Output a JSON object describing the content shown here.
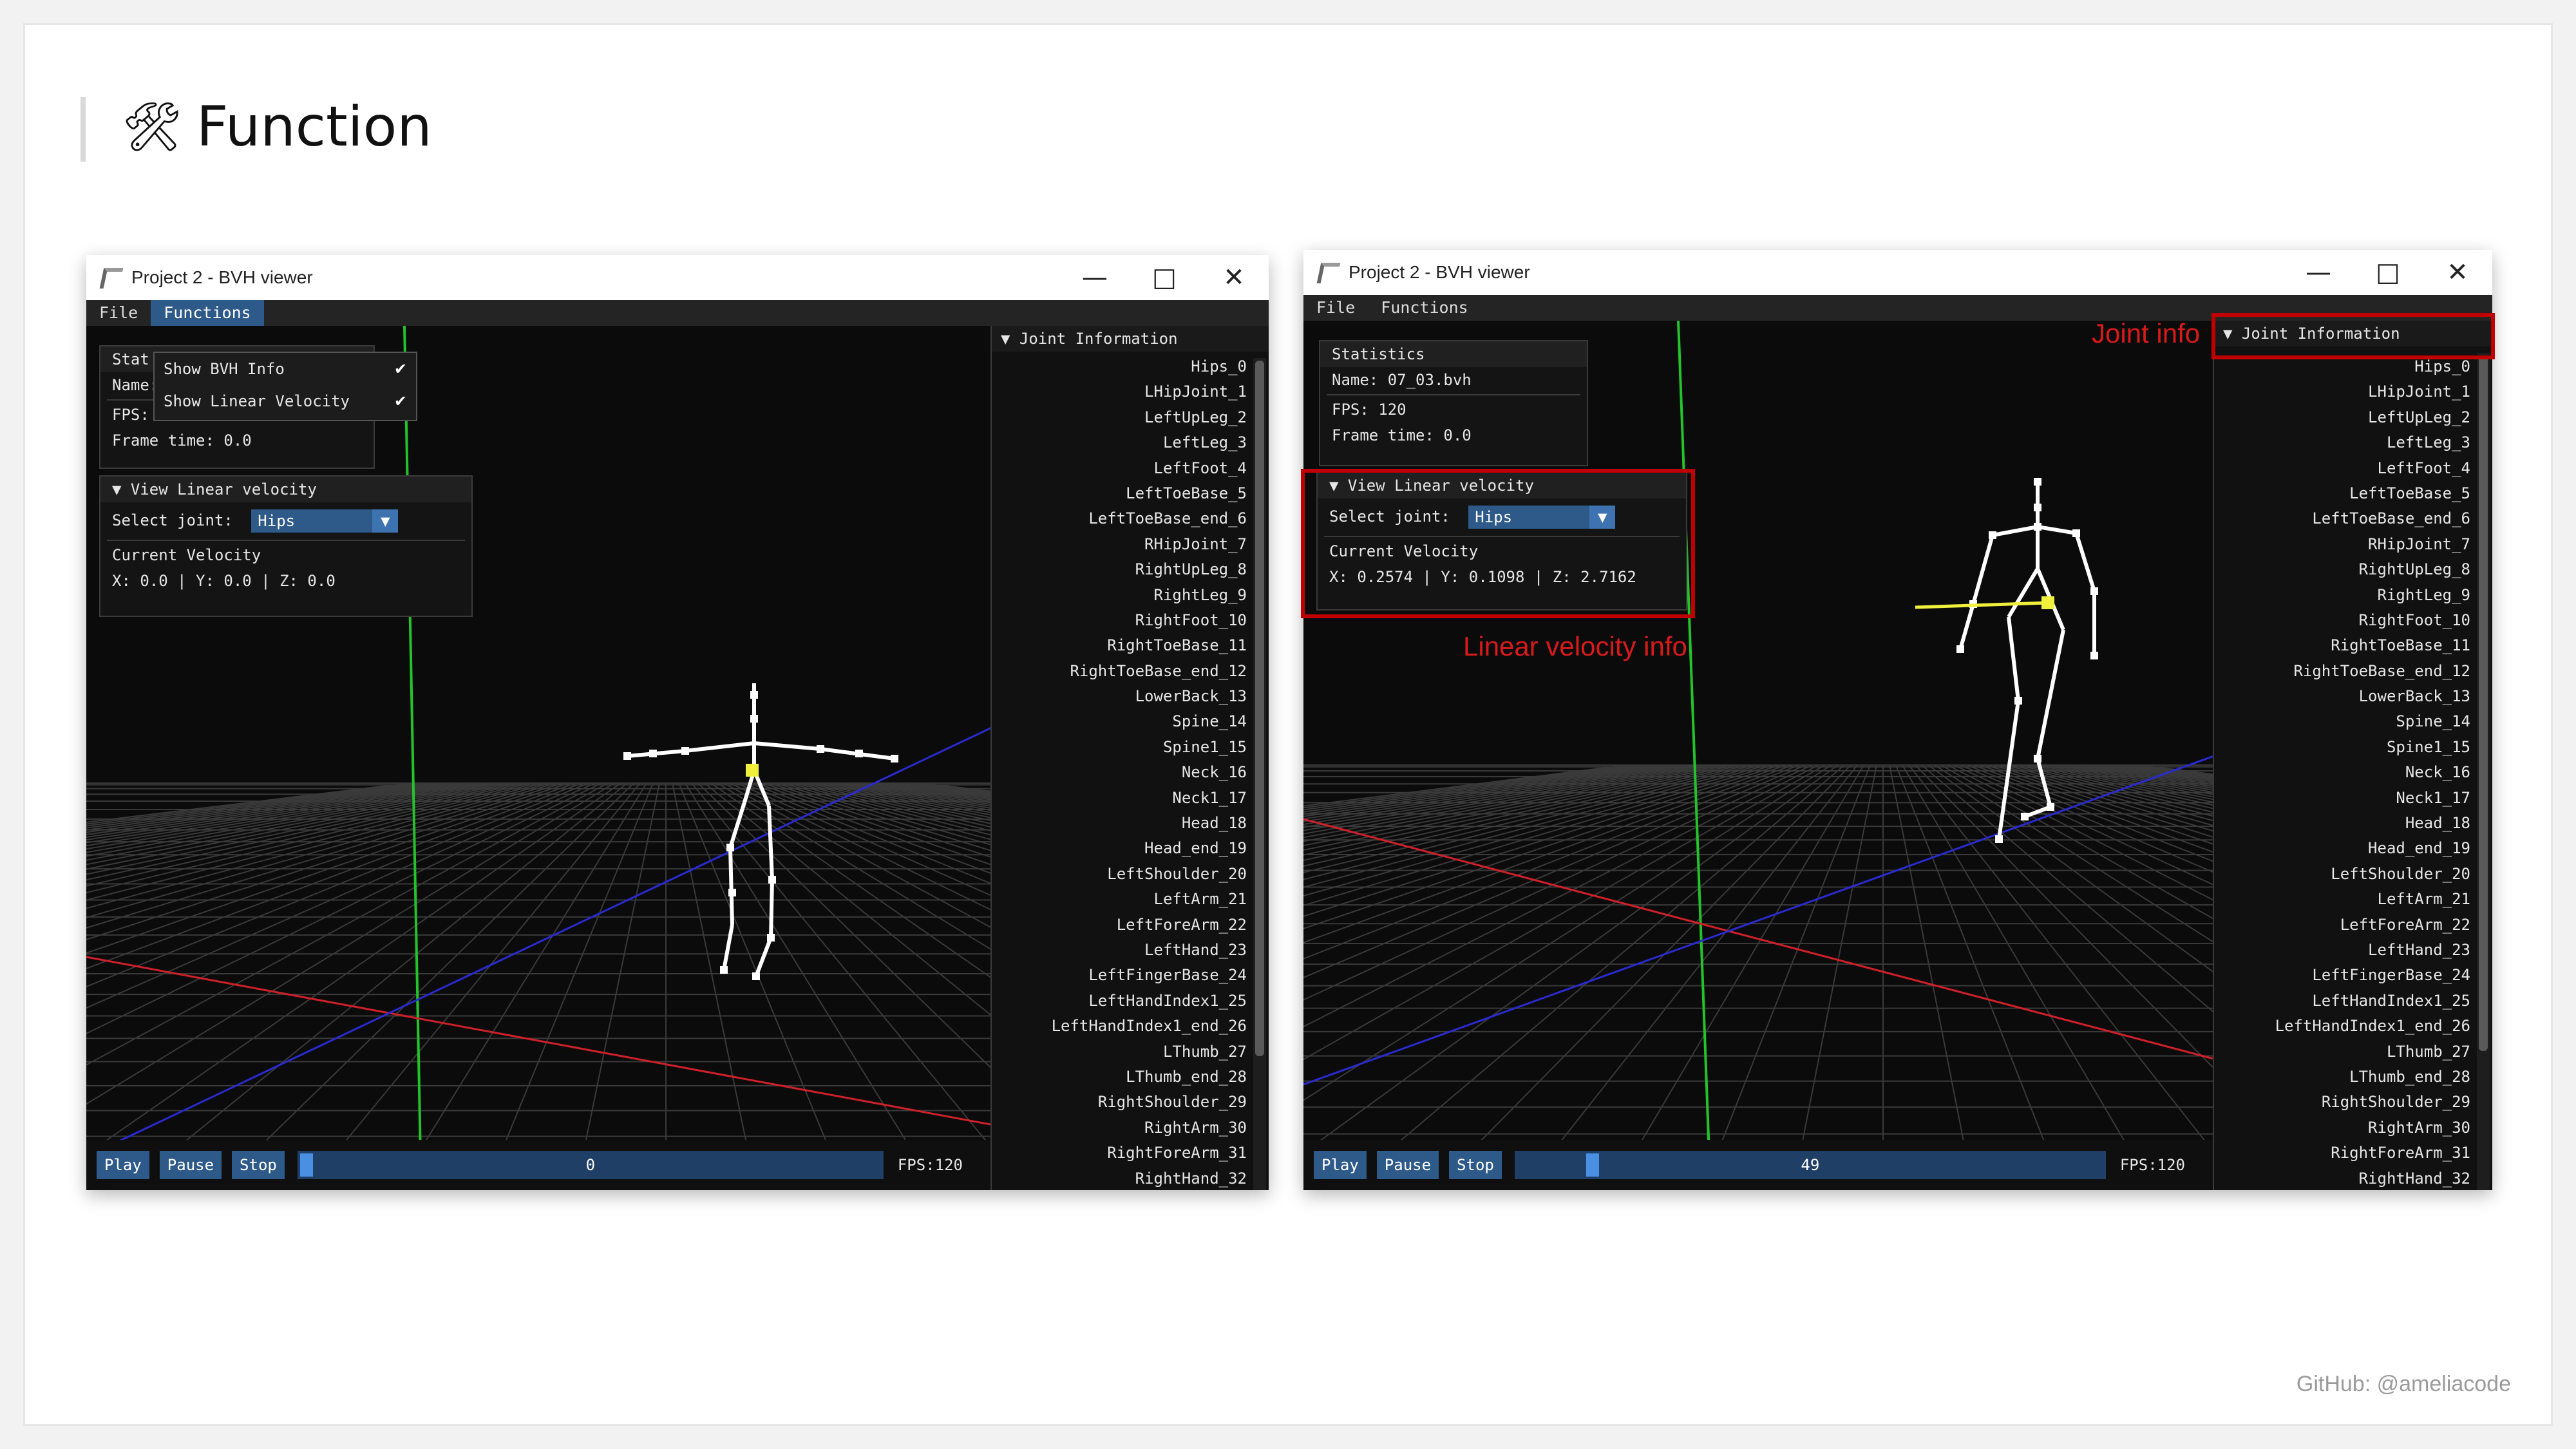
{
  "slide": {
    "title": "Function",
    "title_icon": "hammer-and-wrench-icon",
    "credit": "GitHub: @ameliacode"
  },
  "windows": [
    {
      "title": "Project 2 - BVH viewer",
      "controls": {
        "minimize": "—",
        "maximize": "□",
        "close": "✕"
      },
      "menu": {
        "file": "File",
        "functions": "Functions",
        "active": "Functions"
      },
      "functions_menu": {
        "open": true,
        "items": [
          {
            "label": "Show BVH Info",
            "checked": true
          },
          {
            "label": "Show Linear Velocity",
            "checked": true
          }
        ]
      },
      "stats": {
        "header": "Stat",
        "name": "Name: 07_03.bvh",
        "fps": "FPS: 120",
        "frame_time": "Frame time: 0.0"
      },
      "velocity": {
        "header": "View Linear velocity",
        "select_label": "Select joint:",
        "selected": "Hips",
        "current_label": "Current Velocity",
        "current_value": "X: 0.0 | Y: 0.0 | Z: 0.0"
      },
      "joint_header": "Joint Information",
      "buttons": {
        "play": "Play",
        "pause": "Pause",
        "stop": "Stop"
      },
      "frame": "0",
      "frame_progress": 0.0,
      "fps_label": "FPS:120"
    },
    {
      "title": "Project 2 - BVH viewer",
      "controls": {
        "minimize": "—",
        "maximize": "□",
        "close": "✕"
      },
      "menu": {
        "file": "File",
        "functions": "Functions",
        "active": ""
      },
      "stats": {
        "header": "Statistics",
        "name": "Name: 07_03.bvh",
        "fps": "FPS: 120",
        "frame_time": "Frame time: 0.0"
      },
      "velocity": {
        "header": "View Linear velocity",
        "select_label": "Select joint:",
        "selected": "Hips",
        "current_label": "Current Velocity",
        "current_value": "X: 0.2574 | Y: 0.1098 | Z: 2.7162"
      },
      "joint_header": "Joint Information",
      "buttons": {
        "play": "Play",
        "pause": "Pause",
        "stop": "Stop"
      },
      "frame": "49",
      "frame_progress": 0.12,
      "fps_label": "FPS:120",
      "annotations": {
        "joint_info": "Joint info",
        "velocity_info": "Linear velocity info",
        "color": "#d91a1a"
      }
    }
  ],
  "joints": [
    "Hips_0",
    "LHipJoint_1",
    "LeftUpLeg_2",
    "LeftLeg_3",
    "LeftFoot_4",
    "LeftToeBase_5",
    "LeftToeBase_end_6",
    "RHipJoint_7",
    "RightUpLeg_8",
    "RightLeg_9",
    "RightFoot_10",
    "RightToeBase_11",
    "RightToeBase_end_12",
    "LowerBack_13",
    "Spine_14",
    "Spine1_15",
    "Neck_16",
    "Neck1_17",
    "Head_18",
    "Head_end_19",
    "LeftShoulder_20",
    "LeftArm_21",
    "LeftForeArm_22",
    "LeftHand_23",
    "LeftFingerBase_24",
    "LeftHandIndex1_25",
    "LeftHandIndex1_end_26",
    "LThumb_27",
    "LThumb_end_28",
    "RightShoulder_29",
    "RightArm_30",
    "RightForeArm_31",
    "RightHand_32"
  ],
  "colors": {
    "selection_blue": "#2e5a8a",
    "axis_x": "#d0202a",
    "axis_y": "#22c42a",
    "axis_z": "#2a2ad0",
    "grid": "#3a3a3a",
    "highlight_joint": "#f0f03c"
  }
}
